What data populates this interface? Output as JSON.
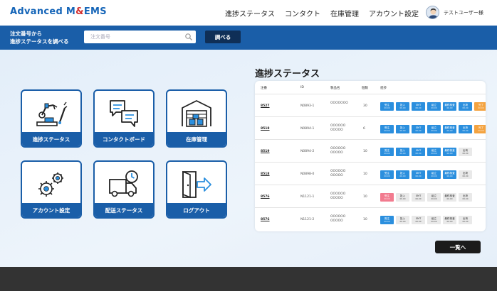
{
  "header": {
    "logo_main": "Advanced M",
    "logo_amp": "&",
    "logo_end": "EMS",
    "nav": [
      "進捗ステータス",
      "コンタクト",
      "在庫管理",
      "アカウント設定"
    ],
    "user_name": "テストユーザー様"
  },
  "search": {
    "label_line1": "注文番号から",
    "label_line2": "進捗ステータスを調べる",
    "placeholder": "注文番号",
    "button_label": "調べる"
  },
  "tiles": [
    {
      "label": "進捗ステータス",
      "icon": "robot-arm-icon"
    },
    {
      "label": "コンタクトボード",
      "icon": "chat-bubbles-icon"
    },
    {
      "label": "在庫管理",
      "icon": "warehouse-icon"
    },
    {
      "label": "アカウント設定",
      "icon": "gears-icon"
    },
    {
      "label": "配送ステータス",
      "icon": "delivery-truck-icon"
    },
    {
      "label": "ログアウト",
      "icon": "logout-door-icon"
    }
  ],
  "status": {
    "title": "進捗ステータス",
    "columns": [
      "注番",
      "ID",
      "製品名",
      "個数",
      "進捗"
    ],
    "rows": [
      {
        "order": "8527",
        "id": "N0893-1",
        "product": "OOOOOOO",
        "qty": "30",
        "chips": [
          "blue",
          "blue",
          "blue",
          "blue",
          "blue",
          "blue",
          "orange"
        ]
      },
      {
        "order": "8518",
        "id": "N0894-1",
        "product": "OOOOOO\nOOOOO",
        "qty": "6",
        "chips": [
          "blue",
          "blue",
          "blue",
          "blue",
          "blue",
          "blue",
          "orange"
        ]
      },
      {
        "order": "8519",
        "id": "N0894-2",
        "product": "OOOOOO\nOOOOO",
        "qty": "10",
        "chips": [
          "blue",
          "blue",
          "blue",
          "blue",
          "blue",
          "grey"
        ]
      },
      {
        "order": "8518",
        "id": "N0898-0",
        "product": "OOOOOO\nOOOOO",
        "qty": "10",
        "chips": [
          "blue",
          "blue",
          "blue",
          "blue",
          "blue",
          "grey"
        ]
      },
      {
        "order": "8576",
        "id": "N1121-1",
        "product": "OOOOOO\nOOOOO",
        "qty": "10",
        "chips": [
          "pink",
          "grey",
          "grey",
          "grey",
          "grey",
          "grey"
        ]
      },
      {
        "order": "8576",
        "id": "N1121-2",
        "product": "OOOOOO\nOOOOO",
        "qty": "10",
        "chips": [
          "blue",
          "grey",
          "grey",
          "grey",
          "grey",
          "grey"
        ]
      }
    ],
    "chip_labels": [
      "受注",
      "投入",
      "SMT",
      "組立",
      "最終検査",
      "出荷",
      "完了"
    ],
    "chip_dates": [
      "00.00",
      "00.00",
      "00.00",
      "00.00",
      "00.00",
      "00.00",
      "00.00"
    ]
  },
  "list_button_label": "一覧へ",
  "colors": {
    "primary": "#1a5ea8",
    "dark": "#0f2f57",
    "chip_blue": "#2b8fde",
    "chip_orange": "#f4a340",
    "chip_pink": "#f27b8f",
    "footer": "#333333"
  }
}
